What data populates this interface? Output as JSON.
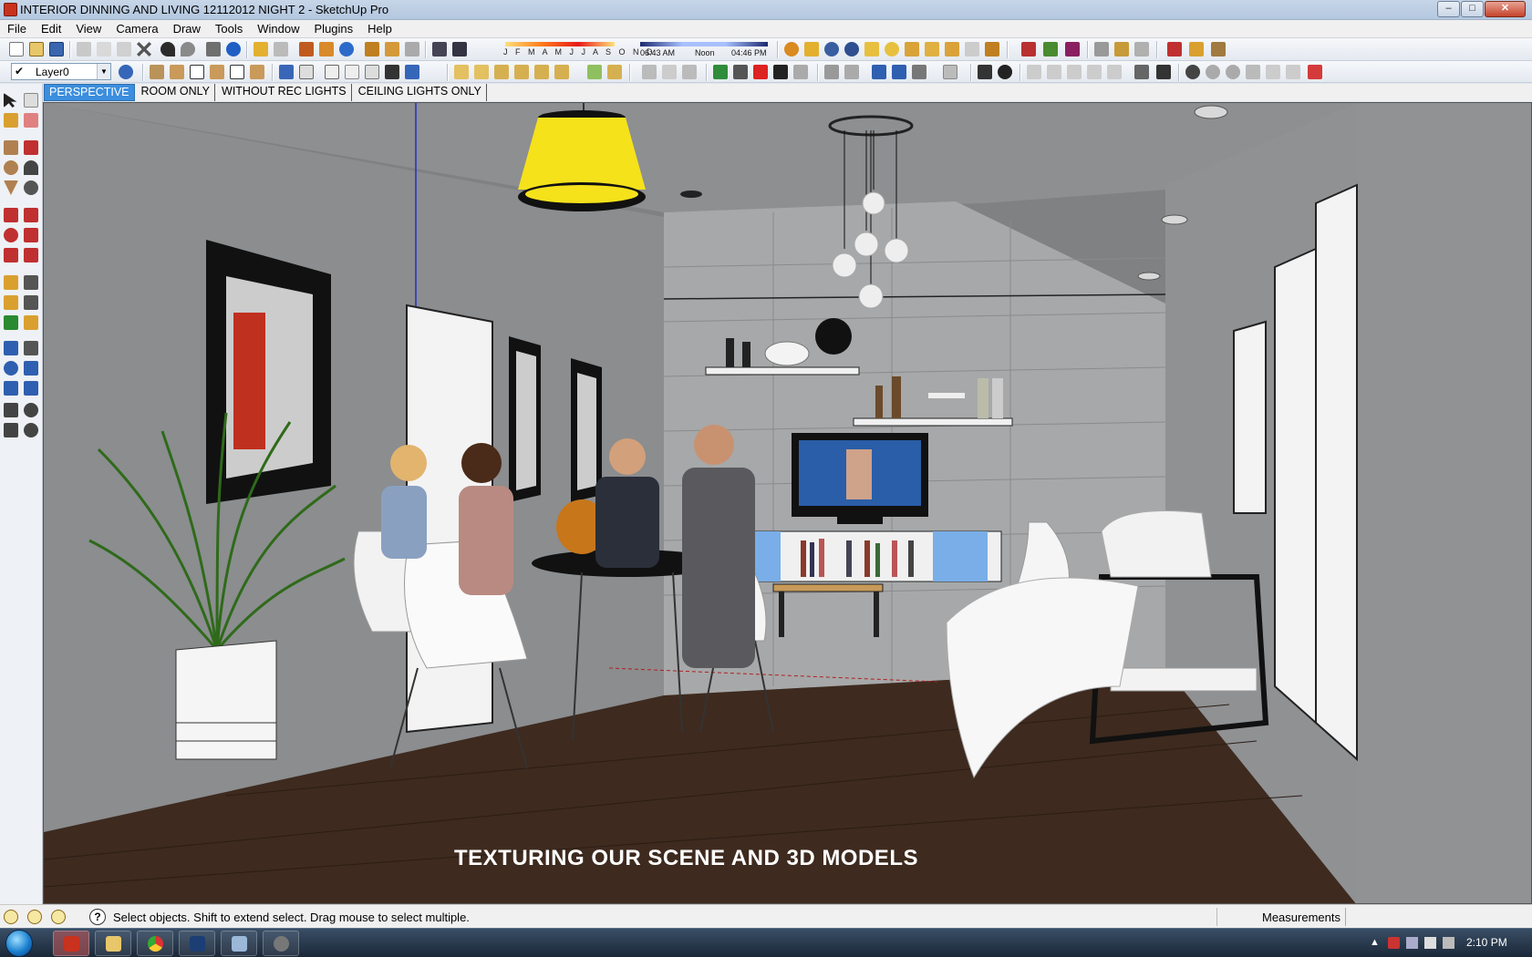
{
  "window": {
    "title": "INTERIOR DINNING AND LIVING 12112012 NIGHT 2 - SketchUp Pro",
    "minimize_glyph": "–",
    "maximize_glyph": "□",
    "close_glyph": "✕"
  },
  "menu": [
    "File",
    "Edit",
    "View",
    "Camera",
    "Draw",
    "Tools",
    "Window",
    "Plugins",
    "Help"
  ],
  "shadow_settings": {
    "months": "J F M A M J J A S O N D",
    "time_start": "06:43 AM",
    "time_mid": "Noon",
    "time_end": "04:46 PM"
  },
  "layer": {
    "check": "✔",
    "name": "Layer0",
    "arrow": "▼"
  },
  "scenes": [
    {
      "label": "PERSPECTIVE",
      "active": true
    },
    {
      "label": "ROOM ONLY",
      "active": false
    },
    {
      "label": "WITHOUT REC LIGHTS",
      "active": false
    },
    {
      "label": "CEILING LIGHTS ONLY",
      "active": false
    }
  ],
  "viewport": {
    "caption": "TEXTURING OUR SCENE AND 3D MODELS"
  },
  "status": {
    "help_glyph": "?",
    "text": "Select objects. Shift to extend select. Drag mouse to select multiple.",
    "measurements_label": "Measurements",
    "measurements_value": ""
  },
  "taskbar": {
    "clock": "2:10 PM"
  },
  "colors": {
    "accent": "#3c8ede",
    "lamp_yellow": "#f5e21b",
    "floor": "#3e2a1f",
    "wall": "#8a8c8e"
  }
}
